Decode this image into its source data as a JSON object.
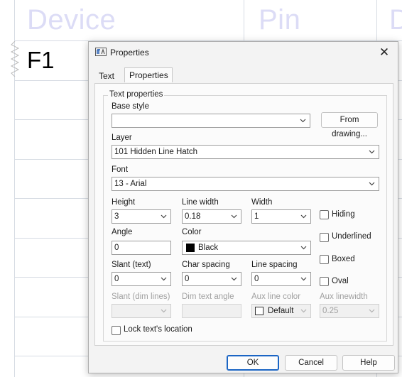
{
  "background": {
    "headers": [
      "Device",
      "Pin",
      "D"
    ],
    "cell": "F1"
  },
  "dialog": {
    "title": "Properties",
    "close_icon": "close-icon",
    "tabs": [
      {
        "label": "Text",
        "active": false
      },
      {
        "label": "Properties",
        "active": true
      }
    ],
    "group_title": "Text properties",
    "base_style": {
      "label": "Base style",
      "value": "",
      "button": "From drawing..."
    },
    "layer": {
      "label": "Layer",
      "value": "101 Hidden Line Hatch"
    },
    "font": {
      "label": "Font",
      "value": "13 - Arial"
    },
    "height": {
      "label": "Height",
      "value": "3"
    },
    "line_width": {
      "label": "Line width",
      "value": "0.18"
    },
    "width": {
      "label": "Width",
      "value": "1"
    },
    "angle": {
      "label": "Angle",
      "value": "0"
    },
    "color": {
      "label": "Color",
      "value": "Black",
      "swatch": "#000000"
    },
    "slant_text": {
      "label": "Slant (text)",
      "value": "0"
    },
    "char_spacing": {
      "label": "Char spacing",
      "value": "0"
    },
    "line_spacing": {
      "label": "Line spacing",
      "value": "0"
    },
    "checks": {
      "hiding": "Hiding",
      "underlined": "Underlined",
      "boxed": "Boxed",
      "oval": "Oval"
    },
    "slant_dim": {
      "label": "Slant (dim lines)",
      "value": ""
    },
    "dim_text_angle": {
      "label": "Dim text angle",
      "value": ""
    },
    "aux_line_color": {
      "label": "Aux line color",
      "value": "Default"
    },
    "aux_linewidth": {
      "label": "Aux linewidth",
      "value": "0.25"
    },
    "lock_location": {
      "label": "Lock text's location",
      "checked": false
    },
    "buttons": {
      "ok": "OK",
      "cancel": "Cancel",
      "help": "Help"
    }
  }
}
